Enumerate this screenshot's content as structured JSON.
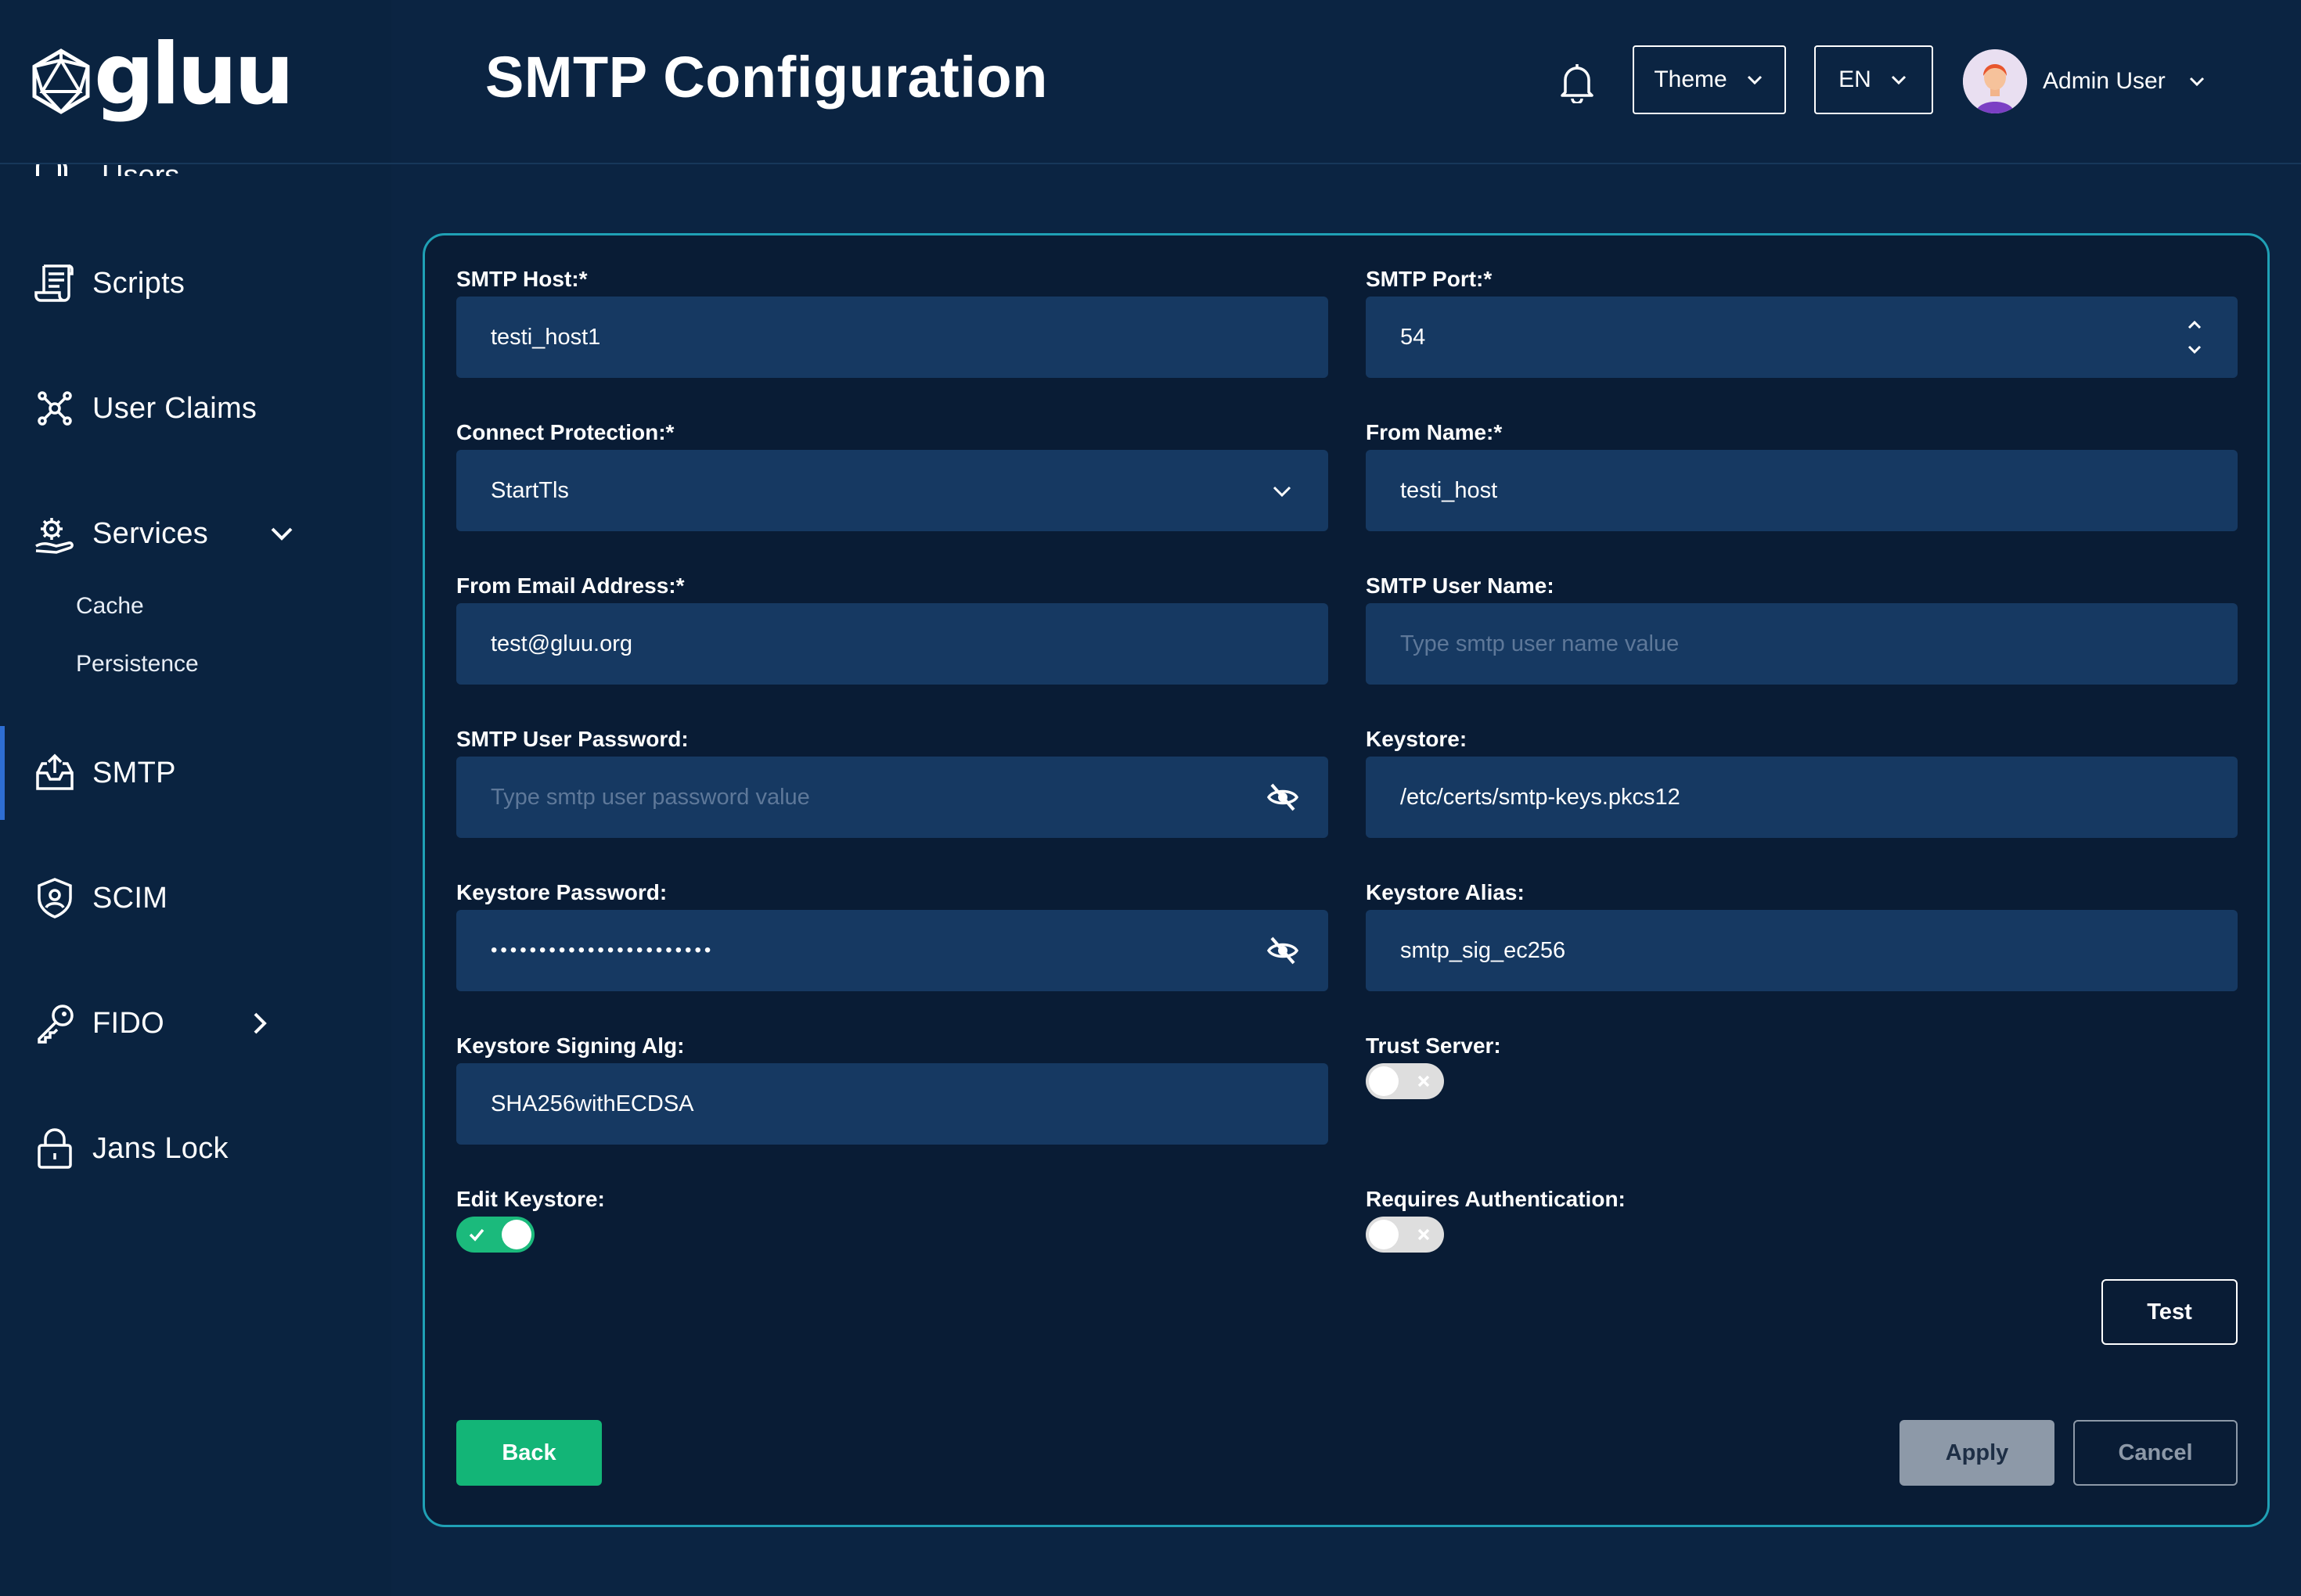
{
  "app": {
    "logo_text": "gluu"
  },
  "sidebar": {
    "cut_item_label": "Users",
    "items": [
      {
        "label": "Scripts",
        "icon": "scroll-icon"
      },
      {
        "label": "User Claims",
        "icon": "hub-icon"
      },
      {
        "label": "Services",
        "icon": "gears-hand-icon",
        "expanded": true
      },
      {
        "label": "SMTP",
        "icon": "inbox-upload-icon",
        "active": true
      },
      {
        "label": "SCIM",
        "icon": "shield-user-icon"
      },
      {
        "label": "FIDO",
        "icon": "key-icon"
      },
      {
        "label": "Jans Lock",
        "icon": "lock-icon"
      }
    ],
    "services_sub": [
      "Cache",
      "Persistence"
    ]
  },
  "header": {
    "title": "SMTP Configuration",
    "theme_label": "Theme",
    "lang_label": "EN",
    "user_name": "Admin User"
  },
  "form": {
    "smtp_host": {
      "label": "SMTP Host:*",
      "value": "testi_host1"
    },
    "smtp_port": {
      "label": "SMTP Port:*",
      "value": "54"
    },
    "connect_protection": {
      "label": "Connect Protection:*",
      "value": "StartTls"
    },
    "from_name": {
      "label": "From Name:*",
      "value": "testi_host"
    },
    "from_email": {
      "label": "From Email Address:*",
      "value": "test@gluu.org"
    },
    "smtp_user_name": {
      "label": "SMTP User Name:",
      "value": "",
      "placeholder": "Type smtp user name value"
    },
    "smtp_user_password": {
      "label": "SMTP User Password:",
      "value": "",
      "placeholder": "Type smtp user password value"
    },
    "keystore": {
      "label": "Keystore:",
      "value": "/etc/certs/smtp-keys.pkcs12"
    },
    "keystore_password": {
      "label": "Keystore Password:",
      "value": "•••••••••••••••••••••••"
    },
    "keystore_alias": {
      "label": "Keystore Alias:",
      "value": "smtp_sig_ec256"
    },
    "keystore_signing_alg": {
      "label": "Keystore Signing Alg:",
      "value": "SHA256withECDSA"
    },
    "trust_server": {
      "label": "Trust Server:",
      "on": false
    },
    "edit_keystore": {
      "label": "Edit Keystore:",
      "on": true
    },
    "requires_auth": {
      "label": "Requires Authentication:",
      "on": false
    }
  },
  "buttons": {
    "test": "Test",
    "back": "Back",
    "apply": "Apply",
    "cancel": "Cancel"
  },
  "colors": {
    "background": "#0b2442",
    "card_border": "#1fa0b5",
    "input_bg": "#163962",
    "accent_green": "#13b577",
    "active_indicator": "#2e6ed3"
  }
}
